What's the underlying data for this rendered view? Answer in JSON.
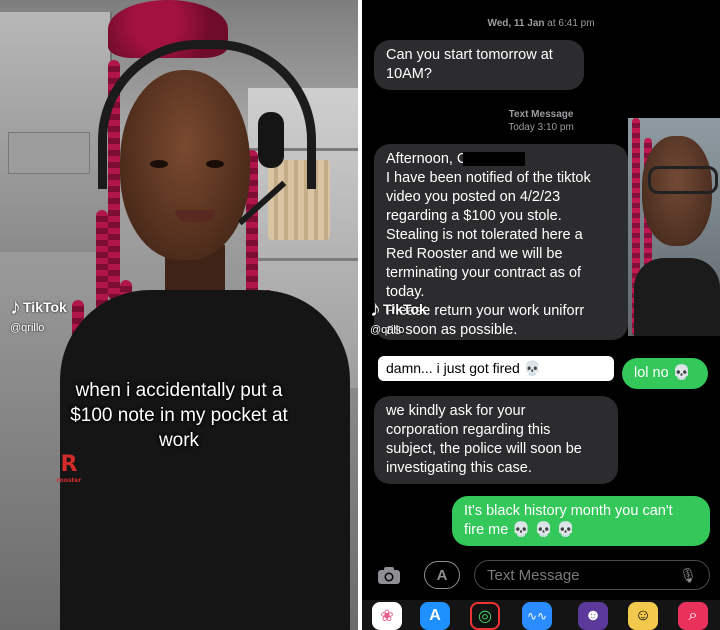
{
  "left_panel": {
    "watermark": {
      "brand": "TikTok",
      "handle": "@qrillo"
    },
    "caption_lines": [
      "when i accidentally put a",
      "$100 note in my pocket at",
      "work"
    ],
    "shirt_logo": {
      "mark": "R",
      "sub": "rooster"
    }
  },
  "messages": {
    "timestamp_1": {
      "day": "Wed, 11 Jan",
      "time": "at 6:41 pm"
    },
    "bubble_1_lines": [
      "Can you start tomorrow at",
      "10AM?"
    ],
    "timestamp_2": {
      "label": "Text Message",
      "time": "Today 3:10 pm"
    },
    "bubble_2_lines": [
      "Afternoon, C",
      "I have been notified of the tiktok",
      "video you posted on 4/2/23",
      "regarding a $100 you stole.",
      "Stealing is not tolerated here a",
      "Red Rooster and we will be",
      "terminating your contract as of",
      "today.",
      "Please return your work uniforr",
      "as soon as possible."
    ],
    "white_label": "damn... i just got fired",
    "white_label_emoji": "💀",
    "reply_green_1": {
      "text": "lol no",
      "emoji": "💀"
    },
    "bubble_3_lines": [
      "we kindly ask for your",
      "corporation regarding this",
      "subject, the police will soon be",
      "investigating this case."
    ],
    "reply_green_2_lines": [
      "It's black history month you can't",
      "fire me"
    ],
    "reply_green_2_emoji": "💀 💀 💀",
    "watermark": {
      "brand": "TikTok",
      "handle": "@qrillo"
    }
  },
  "composer": {
    "placeholder": "Text Message",
    "icons": [
      "camera-icon",
      "app-store-icon",
      "microphone-icon"
    ]
  },
  "app_drawer": {
    "apps": [
      "photos-app",
      "app-store-app",
      "activity-app",
      "audio-app",
      "memoji-app",
      "animoji-app",
      "search-images-app"
    ]
  },
  "colors": {
    "bubble_gray": "#2c2c2e",
    "bubble_green": "#34c759",
    "timestamp": "#9c9ca0"
  }
}
